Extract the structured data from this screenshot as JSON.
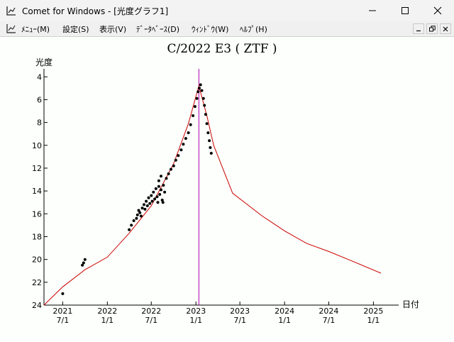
{
  "window": {
    "title": "Comet for Windows - [光度グラフ1]",
    "icon": "graph-app-icon",
    "controls": [
      "minimize-icon",
      "maximize-icon",
      "close-icon"
    ]
  },
  "menu": {
    "items": [
      {
        "label": "ﾒﾆｭｰ(M)"
      },
      {
        "label": "設定(S)"
      },
      {
        "label": "表示(V)"
      },
      {
        "label": "ﾃﾞｰﾀﾍﾞｰｽ(D)"
      },
      {
        "label": "ｳｨﾝﾄﾞｳ(W)"
      },
      {
        "label": "ﾍﾙﾌﾟ(H)"
      }
    ],
    "mdi_controls": [
      "mdi-minimize-icon",
      "mdi-restore-icon",
      "mdi-close-icon"
    ]
  },
  "chart_data": {
    "type": "scatter",
    "title": "C/2022 E3 ( ZTF )",
    "ylabel": "光度",
    "xlabel": "日付",
    "ylim": [
      24,
      3.3
    ],
    "y_inverted": true,
    "y_ticks": [
      4,
      6,
      8,
      10,
      12,
      14,
      16,
      18,
      20,
      22,
      24
    ],
    "xlim": [
      "2021-04-15",
      "2025-04-15"
    ],
    "x_ticks": [
      {
        "date": "2021-07-01",
        "year": "2021",
        "md": "7/1"
      },
      {
        "date": "2022-01-01",
        "year": "2022",
        "md": "1/1"
      },
      {
        "date": "2022-07-01",
        "year": "2022",
        "md": "7/1"
      },
      {
        "date": "2023-01-01",
        "year": "2023",
        "md": "1/1"
      },
      {
        "date": "2023-07-01",
        "year": "2023",
        "md": "7/1"
      },
      {
        "date": "2024-01-01",
        "year": "2024",
        "md": "1/1"
      },
      {
        "date": "2024-07-01",
        "year": "2024",
        "md": "7/1"
      },
      {
        "date": "2025-01-01",
        "year": "2025",
        "md": "1/1"
      }
    ],
    "perihelion_line": {
      "date": "2023-01-13",
      "color": "#b000b0"
    },
    "predicted_curve": {
      "color": "#cc0000",
      "points": [
        [
          "2021-04-15",
          24.0
        ],
        [
          "2021-07-01",
          22.4
        ],
        [
          "2021-10-01",
          20.9
        ],
        [
          "2022-01-01",
          19.8
        ],
        [
          "2022-04-01",
          17.7
        ],
        [
          "2022-07-01",
          15.3
        ],
        [
          "2022-10-01",
          11.6
        ],
        [
          "2022-12-01",
          8.1
        ],
        [
          "2023-01-13",
          4.8
        ],
        [
          "2023-02-15",
          7.4
        ],
        [
          "2023-03-15",
          10.0
        ],
        [
          "2023-06-01",
          14.2
        ],
        [
          "2023-10-01",
          16.2
        ],
        [
          "2024-01-01",
          17.5
        ],
        [
          "2024-04-01",
          18.6
        ],
        [
          "2024-07-01",
          19.3
        ],
        [
          "2024-10-01",
          20.1
        ],
        [
          "2025-02-01",
          21.2
        ]
      ]
    },
    "observations": {
      "color": "#000000",
      "points": [
        [
          "2021-07-01",
          23.0
        ],
        [
          "2021-09-20",
          20.5
        ],
        [
          "2021-09-25",
          20.3
        ],
        [
          "2021-10-01",
          20.0
        ],
        [
          "2022-04-01",
          17.4
        ],
        [
          "2022-04-10",
          17.0
        ],
        [
          "2022-04-20",
          16.6
        ],
        [
          "2022-05-01",
          16.4
        ],
        [
          "2022-05-05",
          16.1
        ],
        [
          "2022-05-10",
          15.7
        ],
        [
          "2022-05-15",
          15.9
        ],
        [
          "2022-05-20",
          16.2
        ],
        [
          "2022-05-25",
          15.5
        ],
        [
          "2022-06-01",
          15.2
        ],
        [
          "2022-06-05",
          15.6
        ],
        [
          "2022-06-10",
          14.9
        ],
        [
          "2022-06-15",
          15.3
        ],
        [
          "2022-06-20",
          14.6
        ],
        [
          "2022-06-25",
          15.1
        ],
        [
          "2022-07-01",
          14.4
        ],
        [
          "2022-07-05",
          14.9
        ],
        [
          "2022-07-10",
          14.1
        ],
        [
          "2022-07-15",
          14.7
        ],
        [
          "2022-07-20",
          13.8
        ],
        [
          "2022-07-25",
          14.5
        ],
        [
          "2022-08-01",
          13.6
        ],
        [
          "2022-08-05",
          14.3
        ],
        [
          "2022-08-10",
          13.9
        ],
        [
          "2022-08-15",
          14.8
        ],
        [
          "2022-08-20",
          13.5
        ],
        [
          "2022-08-25",
          14.1
        ],
        [
          "2022-08-01",
          13.1
        ],
        [
          "2022-08-10",
          12.7
        ],
        [
          "2022-07-28",
          15.0
        ],
        [
          "2022-08-18",
          15.0
        ],
        [
          "2022-09-01",
          12.9
        ],
        [
          "2022-09-10",
          12.5
        ],
        [
          "2022-09-20",
          12.1
        ],
        [
          "2022-10-01",
          11.8
        ],
        [
          "2022-10-10",
          11.3
        ],
        [
          "2022-10-20",
          10.9
        ],
        [
          "2022-11-01",
          10.4
        ],
        [
          "2022-11-10",
          9.9
        ],
        [
          "2022-11-20",
          9.4
        ],
        [
          "2022-12-01",
          8.9
        ],
        [
          "2022-12-10",
          8.2
        ],
        [
          "2022-12-20",
          7.4
        ],
        [
          "2022-12-28",
          6.6
        ],
        [
          "2023-01-05",
          5.9
        ],
        [
          "2023-01-10",
          5.3
        ],
        [
          "2023-01-15",
          5.0
        ],
        [
          "2023-01-20",
          4.7
        ],
        [
          "2023-01-25",
          5.2
        ],
        [
          "2023-02-01",
          5.9
        ],
        [
          "2023-02-05",
          6.5
        ],
        [
          "2023-02-10",
          7.3
        ],
        [
          "2023-02-15",
          8.1
        ],
        [
          "2023-02-20",
          8.9
        ],
        [
          "2023-02-25",
          9.6
        ],
        [
          "2023-03-01",
          10.2
        ],
        [
          "2023-03-05",
          10.7
        ]
      ]
    }
  }
}
